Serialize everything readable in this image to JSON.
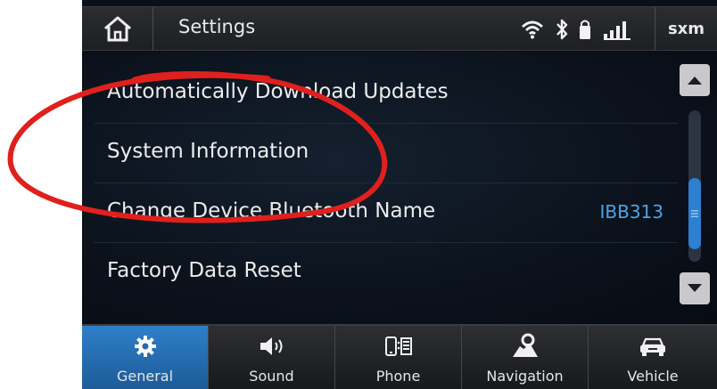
{
  "header": {
    "title": "Settings",
    "home_icon": "home-icon",
    "status_icons": [
      "wifi-icon",
      "bluetooth-icon",
      "battery-lock-icon",
      "signal-icon"
    ],
    "sxm_label": "sxm"
  },
  "list": {
    "items": [
      {
        "label": "Automatically Download Updates",
        "value": ""
      },
      {
        "label": "System Information",
        "value": ""
      },
      {
        "label": "Change Device Bluetooth Name",
        "value": "IBB313"
      },
      {
        "label": "Factory Data Reset",
        "value": ""
      }
    ]
  },
  "nav": {
    "tabs": [
      {
        "label": "General",
        "icon": "gear-icon",
        "active": true
      },
      {
        "label": "Sound",
        "icon": "speaker-icon",
        "active": false
      },
      {
        "label": "Phone",
        "icon": "phone-icon",
        "active": false
      },
      {
        "label": "Navigation",
        "icon": "map-pin-icon",
        "active": false
      },
      {
        "label": "Vehicle",
        "icon": "car-icon",
        "active": false
      }
    ]
  },
  "colors": {
    "accent": "#2d7fd2",
    "value_text": "#4ea3e6",
    "annotation": "#e0201c"
  }
}
